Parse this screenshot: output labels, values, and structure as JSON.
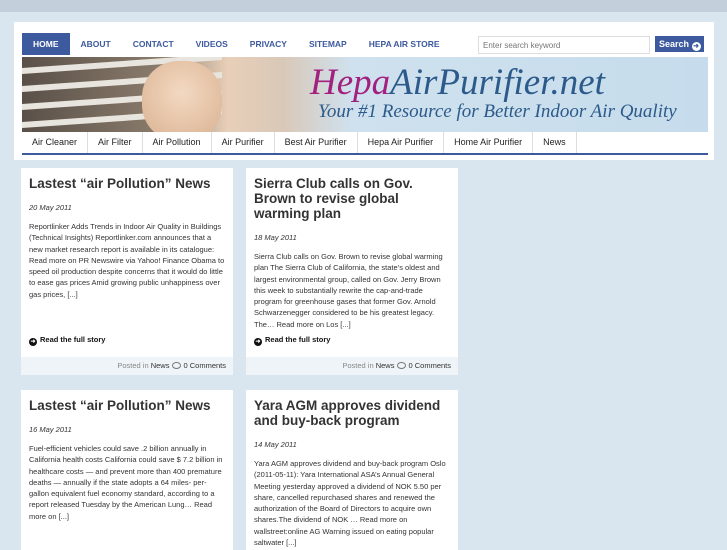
{
  "topnav": [
    "HOME",
    "ABOUT",
    "CONTACT",
    "VIDEOS",
    "PRIVACY",
    "SITEMAP",
    "HEPA AIR STORE"
  ],
  "search": {
    "placeholder": "Enter search keyword",
    "button": "Search"
  },
  "banner": {
    "logo_a": "Hepa",
    "logo_b": "AirPurifier.net",
    "tagline": "Your #1 Resource for Better Indoor Air Quality"
  },
  "catnav": [
    "Air Cleaner",
    "Air Filter",
    "Air Pollution",
    "Air Purifier",
    "Best Air Purifier",
    "Hepa Air Purifier",
    "Home Air Purifier",
    "News"
  ],
  "common": {
    "read_more": "Read the full story",
    "posted_in": "Posted in",
    "category": "News",
    "comments": "0 Comments"
  },
  "posts": [
    {
      "title": "Lastest “air Pollution” News",
      "date": "20 May 2011",
      "excerpt": "Reportlinker Adds Trends in Indoor Air Quality in Buildings (Technical Insights) Reportlinker.com announces that a new market research report is available in its catalogue: Read more on PR Newswire via Yahoo! Finance Obama to speed oil production despite concerns that it would do little to ease gas prices Amid growing public unhappiness over gas prices, [...]"
    },
    {
      "title": "Sierra Club calls on Gov. Brown to revise global warming plan",
      "date": "18 May 2011",
      "excerpt": "Sierra Club calls on Gov. Brown to revise global warming plan The Sierra Club of California, the state’s oldest and largest environmental group, called on Gov. Jerry Brown this week to substantially rewrite the cap-and-trade program for greenhouse gases that former Gov. Arnold Schwarzenegger considered to be his greatest legacy. The… Read more on Los [...]"
    },
    {
      "title": "Lastest “air Pollution” News",
      "date": "16 May 2011",
      "excerpt": "Fuel-efficient vehicles could save .2 billion annually in California health costs California could save $ 7.2 billion in healthcare costs — and prevent more than 400 premature deaths — annually if the state adopts a 64 miles- per-gallon equivalent fuel economy standard, according to a report released Tuesday by the American Lung… Read more on [...]"
    },
    {
      "title": "Yara AGM approves dividend and buy-back program",
      "date": "14 May 2011",
      "excerpt": "Yara AGM approves dividend and buy-back program Oslo (2011-05-11): Yara International ASA’s Annual General Meeting yesterday approved a dividend of NOK 5.50 per share, cancelled repurchased shares and renewed the authorization of the Board of Directors to acquire own shares.The dividend of NOK … Read more on wallstreet:online AG Warning issued on eating popular saltwater [...]"
    }
  ]
}
